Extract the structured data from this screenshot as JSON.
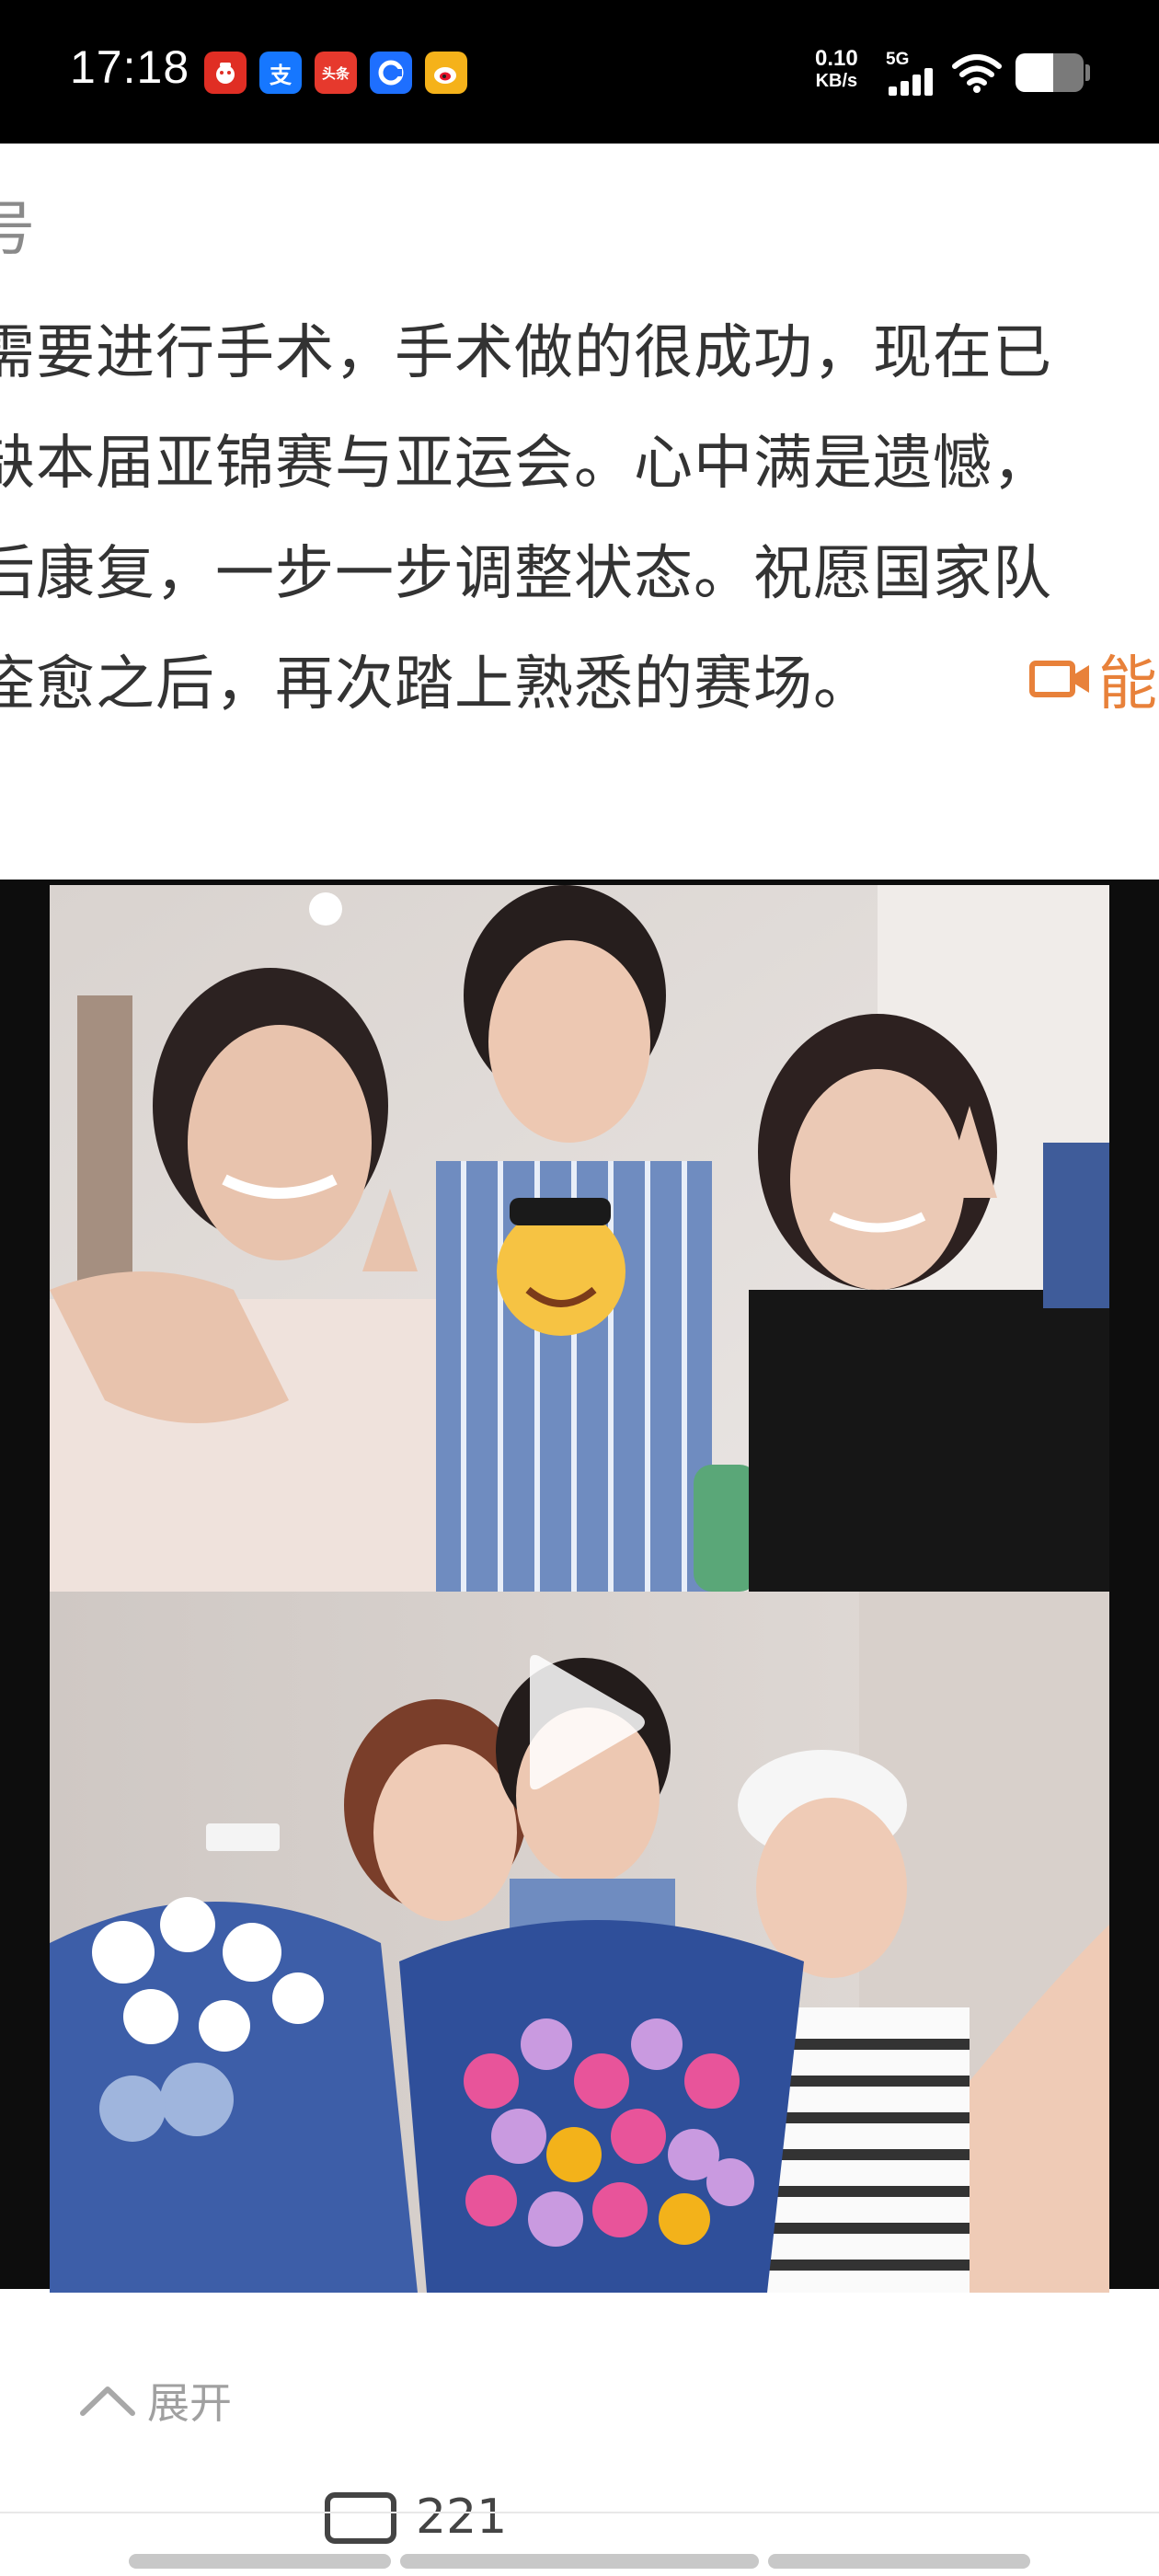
{
  "status_bar": {
    "time": "17:18",
    "app_icons": [
      {
        "name": "pdd-app-icon",
        "glyph": "●",
        "color": "#e02e24"
      },
      {
        "name": "alipay-app-icon",
        "glyph": "支",
        "color": "#1677ff"
      },
      {
        "name": "toutiao-app-icon",
        "glyph": "头条",
        "color": "#e6392d"
      },
      {
        "name": "browser-app-icon",
        "glyph": "C",
        "color": "#1e6fff"
      },
      {
        "name": "weibo-app-icon",
        "glyph": "◎",
        "color": "#f5a623"
      }
    ],
    "net_speed_value": "0.10",
    "net_speed_unit": "KB/s",
    "network_type": "5G",
    "battery_level": 0.55
  },
  "post": {
    "header_fragment": "号",
    "lines": [
      "需要进行手术，手术做的很成功，现在已",
      "缺本届亚锦赛与亚运会。心中满是遗憾，",
      "后康复，一步一步调整状态。祝愿国家队",
      "痊愈之后，再次踏上熟悉的赛场。"
    ],
    "video_link_label": "能",
    "video_link_icon": "video-camera-icon",
    "expand_label": "展开",
    "comment_count": "221"
  },
  "colors": {
    "accent_orange": "#e8813a",
    "status_bar_bg": "#000000",
    "text_main": "#333333",
    "text_muted": "#a0a0a0"
  }
}
